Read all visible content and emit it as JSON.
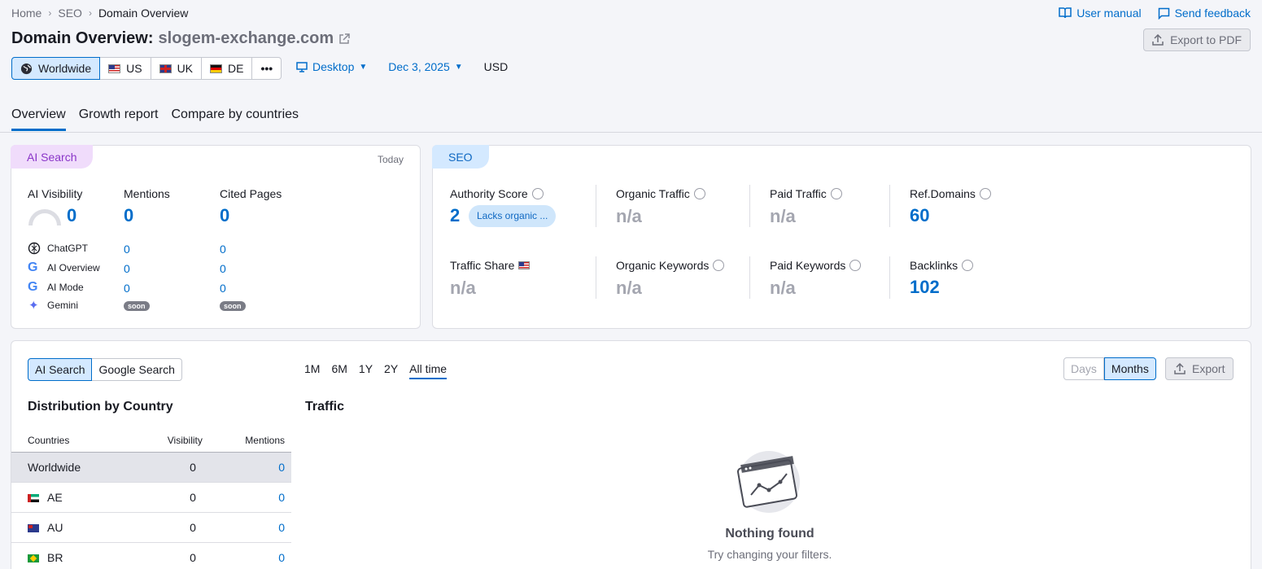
{
  "breadcrumbs": [
    "Home",
    "SEO",
    "Domain Overview"
  ],
  "header": {
    "user_manual": "User manual",
    "send_feedback": "Send feedback",
    "title": "Domain Overview:",
    "domain": "slogem-exchange.com",
    "export_pdf": "Export to PDF"
  },
  "databases": [
    {
      "label": "Worldwide",
      "icon": "globe-icon"
    },
    {
      "label": "US",
      "icon": "us-flag-icon"
    },
    {
      "label": "UK",
      "icon": "uk-flag-icon"
    },
    {
      "label": "DE",
      "icon": "de-flag-icon"
    },
    {
      "label": "•••",
      "icon": "more-icon"
    }
  ],
  "options": {
    "device": "Desktop",
    "date": "Dec 3, 2025",
    "currency": "USD"
  },
  "tabs": [
    "Overview",
    "Growth report",
    "Compare by countries"
  ],
  "ai_card": {
    "pill": "AI Search",
    "date": "Today",
    "visibility_label": "AI Visibility",
    "visibility_value": "0",
    "mentions_label": "Mentions",
    "mentions_value": "0",
    "cited_label": "Cited Pages",
    "cited_value": "0",
    "rows": [
      {
        "name": "ChatGPT",
        "mentions": "0",
        "cited": "0"
      },
      {
        "name": "AI Overview",
        "mentions": "0",
        "cited": "0"
      },
      {
        "name": "AI Mode",
        "mentions": "0",
        "cited": "0"
      },
      {
        "name": "Gemini",
        "mentions": "soon",
        "cited": "soon"
      }
    ]
  },
  "seo_card": {
    "pill": "SEO",
    "authority_label": "Authority Score",
    "authority_value": "2",
    "authority_badge": "Lacks organic ...",
    "organic_traffic_label": "Organic Traffic",
    "organic_traffic_value": "n/a",
    "paid_traffic_label": "Paid Traffic",
    "paid_traffic_value": "n/a",
    "ref_domains_label": "Ref.Domains",
    "ref_domains_value": "60",
    "traffic_share_label": "Traffic Share",
    "traffic_share_value": "n/a",
    "organic_keywords_label": "Organic Keywords",
    "organic_keywords_value": "n/a",
    "paid_keywords_label": "Paid Keywords",
    "paid_keywords_value": "n/a",
    "backlinks_label": "Backlinks",
    "backlinks_value": "102"
  },
  "bottom": {
    "seg": [
      "AI Search",
      "Google Search"
    ],
    "ranges": [
      "1M",
      "6M",
      "1Y",
      "2Y",
      "All time"
    ],
    "granularity": [
      "Days",
      "Months"
    ],
    "export": "Export",
    "distribution_title": "Distribution by Country",
    "traffic_title": "Traffic",
    "table_headers": [
      "Countries",
      "Visibility",
      "Mentions"
    ],
    "table_rows": [
      {
        "country": "Worldwide",
        "visibility": "0",
        "mentions": "0"
      },
      {
        "country": "AE",
        "visibility": "0",
        "mentions": "0"
      },
      {
        "country": "AU",
        "visibility": "0",
        "mentions": "0"
      },
      {
        "country": "BR",
        "visibility": "0",
        "mentions": "0"
      }
    ],
    "empty_title": "Nothing found",
    "empty_sub": "Try changing your filters."
  }
}
